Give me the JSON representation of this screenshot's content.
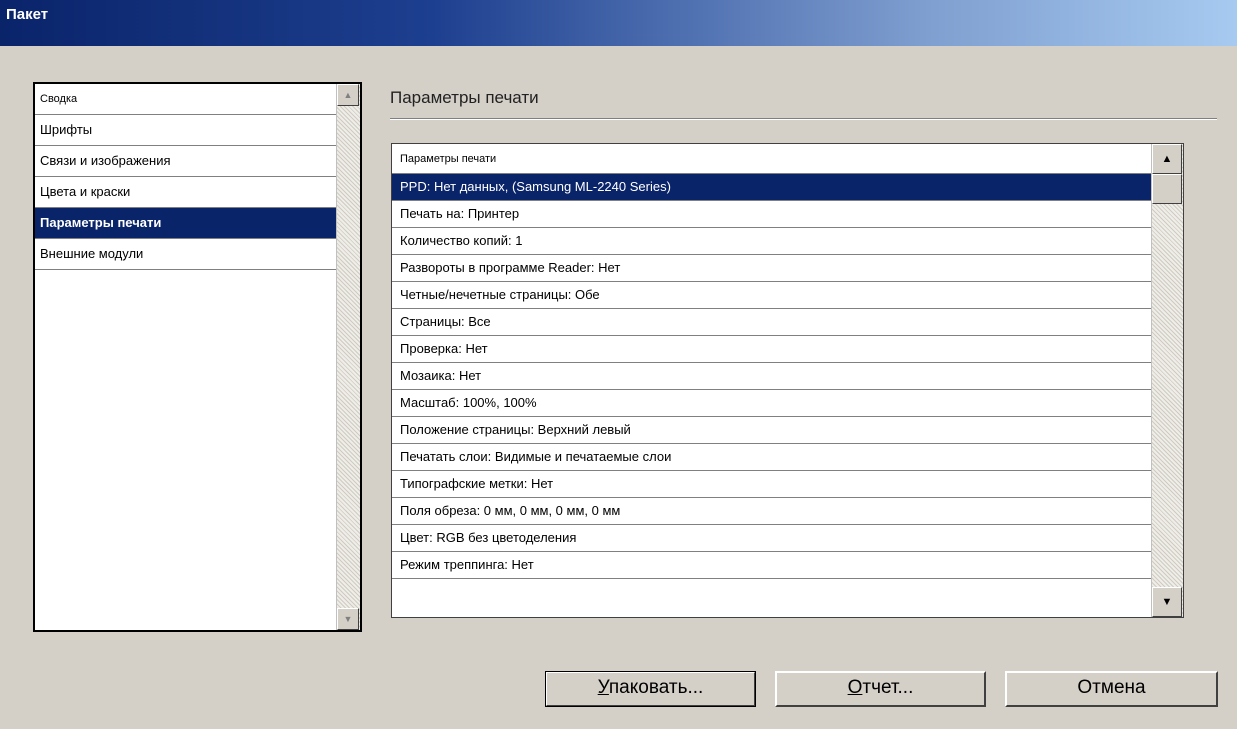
{
  "window": {
    "title": "Пакет"
  },
  "sidebar": {
    "items": [
      {
        "label": "Сводка",
        "selected": false
      },
      {
        "label": "Шрифты",
        "selected": false
      },
      {
        "label": "Связи и изображения",
        "selected": false
      },
      {
        "label": "Цвета и краски",
        "selected": false
      },
      {
        "label": "Параметры печати",
        "selected": true
      },
      {
        "label": "Внешние модули",
        "selected": false
      }
    ]
  },
  "main": {
    "section_title": "Параметры печати",
    "table": {
      "header": "Параметры печати",
      "rows": [
        "PPD: Нет данных, (Samsung ML-2240 Series)",
        "Печать на: Принтер",
        "Количество копий: 1",
        "Развороты в программе Reader: Нет",
        "Четные/нечетные страницы: Обе",
        "Страницы: Все",
        "Проверка: Нет",
        "Мозаика: Нет",
        "Масштаб: 100%, 100%",
        "Положение страницы: Верхний левый",
        "Печатать слои: Видимые и печатаемые слои",
        "Типографские метки: Нет",
        "Поля обреза: 0 мм, 0 мм, 0 мм, 0 мм",
        "Цвет: RGB без цветоделения",
        "Режим треппинга: Нет"
      ],
      "selected_index": 0
    }
  },
  "buttons": {
    "package_first": "У",
    "package_rest": "паковать...",
    "report_first": "О",
    "report_rest": "тчет...",
    "cancel": "Отмена"
  },
  "colors": {
    "selection": "#0a246a",
    "face": "#d4d0c8"
  },
  "icons": {
    "scroll_up": "up-arrow-icon",
    "scroll_down": "down-arrow-icon"
  }
}
